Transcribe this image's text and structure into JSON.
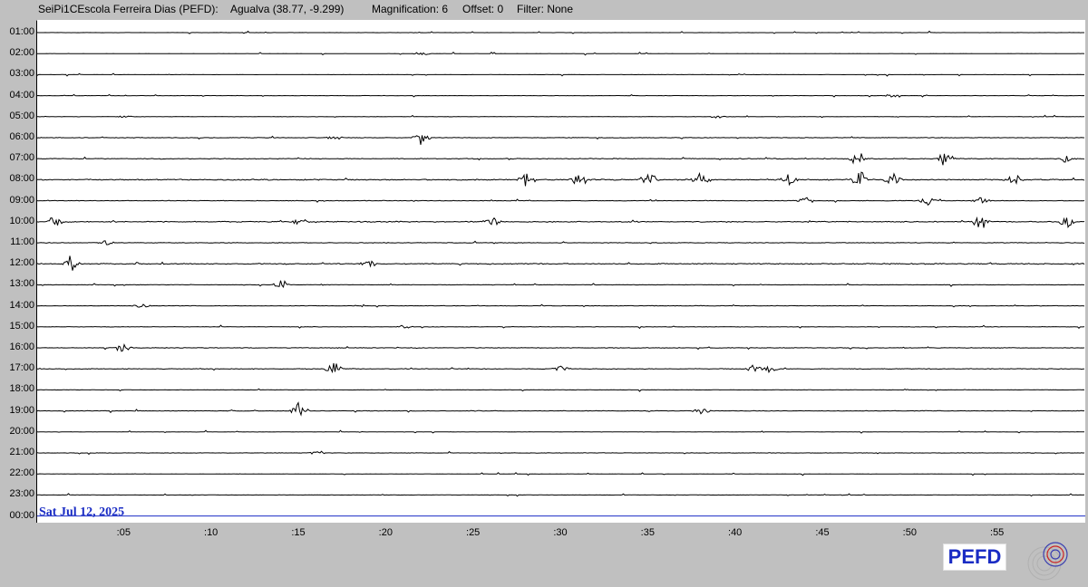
{
  "header": {
    "station": "SeiPi1CEscola Ferreira Dias (PEFD):",
    "location": "Agualva (38.77, -9.299)",
    "magnification": "Magnification: 6",
    "offset": "Offset: 0",
    "filter": "Filter: None"
  },
  "date_label": "Sat Jul 12, 2025",
  "hour_labels": [
    "01:00",
    "02:00",
    "03:00",
    "04:00",
    "05:00",
    "06:00",
    "07:00",
    "08:00",
    "09:00",
    "10:00",
    "11:00",
    "12:00",
    "13:00",
    "14:00",
    "15:00",
    "16:00",
    "17:00",
    "18:00",
    "19:00",
    "20:00",
    "21:00",
    "22:00",
    "23:00",
    "00:00"
  ],
  "minute_ticks": [
    ":05",
    ":10",
    ":15",
    ":20",
    ":25",
    ":30",
    ":35",
    ":40",
    ":45",
    ":50",
    ":55"
  ],
  "logo_text": "PEFD",
  "colors": {
    "background": "#c0c0c0",
    "plot_background": "#ffffff",
    "trace": "#000000",
    "current_hour_line": "#1a2cc4",
    "date_text": "#1a2cc4",
    "logo_text": "#1a2cc4"
  },
  "activity": [
    {
      "hour": "01:00",
      "level": 0.1,
      "bursts": []
    },
    {
      "hour": "02:00",
      "level": 0.1,
      "bursts": [
        {
          "min": 22,
          "amp": 2
        }
      ]
    },
    {
      "hour": "03:00",
      "level": 0.1,
      "bursts": []
    },
    {
      "hour": "04:00",
      "level": 0.15,
      "bursts": [
        {
          "min": 49,
          "amp": 2
        }
      ]
    },
    {
      "hour": "05:00",
      "level": 0.2,
      "bursts": [
        {
          "min": 5,
          "amp": 2
        },
        {
          "min": 39,
          "amp": 2
        }
      ]
    },
    {
      "hour": "06:00",
      "level": 0.3,
      "bursts": [
        {
          "min": 22,
          "amp": 8
        },
        {
          "min": 17,
          "amp": 3
        }
      ]
    },
    {
      "hour": "07:00",
      "level": 0.4,
      "bursts": [
        {
          "min": 47,
          "amp": 9
        },
        {
          "min": 52,
          "amp": 9
        },
        {
          "min": 59,
          "amp": 6
        }
      ]
    },
    {
      "hour": "08:00",
      "level": 0.6,
      "bursts": [
        {
          "min": 28,
          "amp": 10
        },
        {
          "min": 31,
          "amp": 9
        },
        {
          "min": 35,
          "amp": 10
        },
        {
          "min": 38,
          "amp": 10
        },
        {
          "min": 43,
          "amp": 10
        },
        {
          "min": 47,
          "amp": 10
        },
        {
          "min": 49,
          "amp": 10
        },
        {
          "min": 56,
          "amp": 7
        }
      ]
    },
    {
      "hour": "09:00",
      "level": 0.3,
      "bursts": [
        {
          "min": 44,
          "amp": 5
        },
        {
          "min": 51,
          "amp": 6
        },
        {
          "min": 54,
          "amp": 5
        }
      ]
    },
    {
      "hour": "10:00",
      "level": 0.5,
      "bursts": [
        {
          "min": 1,
          "amp": 6
        },
        {
          "min": 15,
          "amp": 6
        },
        {
          "min": 26,
          "amp": 6
        },
        {
          "min": 54,
          "amp": 10
        },
        {
          "min": 59,
          "amp": 8
        }
      ]
    },
    {
      "hour": "11:00",
      "level": 0.3,
      "bursts": [
        {
          "min": 4,
          "amp": 3
        }
      ]
    },
    {
      "hour": "12:00",
      "level": 0.5,
      "bursts": [
        {
          "min": 2,
          "amp": 11
        },
        {
          "min": 19,
          "amp": 5
        }
      ]
    },
    {
      "hour": "13:00",
      "level": 0.2,
      "bursts": [
        {
          "min": 14,
          "amp": 7
        }
      ]
    },
    {
      "hour": "14:00",
      "level": 0.25,
      "bursts": [
        {
          "min": 6,
          "amp": 3
        }
      ]
    },
    {
      "hour": "15:00",
      "level": 0.25,
      "bursts": [
        {
          "min": 21,
          "amp": 3
        }
      ]
    },
    {
      "hour": "16:00",
      "level": 0.3,
      "bursts": [
        {
          "min": 5,
          "amp": 9
        }
      ]
    },
    {
      "hour": "17:00",
      "level": 0.35,
      "bursts": [
        {
          "min": 17,
          "amp": 8
        },
        {
          "min": 30,
          "amp": 5
        },
        {
          "min": 41,
          "amp": 5
        },
        {
          "min": 42,
          "amp": 6
        }
      ]
    },
    {
      "hour": "18:00",
      "level": 0.15,
      "bursts": []
    },
    {
      "hour": "19:00",
      "level": 0.3,
      "bursts": [
        {
          "min": 15,
          "amp": 12
        },
        {
          "min": 38,
          "amp": 4
        }
      ]
    },
    {
      "hour": "20:00",
      "level": 0.15,
      "bursts": []
    },
    {
      "hour": "21:00",
      "level": 0.2,
      "bursts": [
        {
          "min": 16,
          "amp": 3
        }
      ]
    },
    {
      "hour": "22:00",
      "level": 0.15,
      "bursts": []
    },
    {
      "hour": "23:00",
      "level": 0.15,
      "bursts": []
    }
  ]
}
